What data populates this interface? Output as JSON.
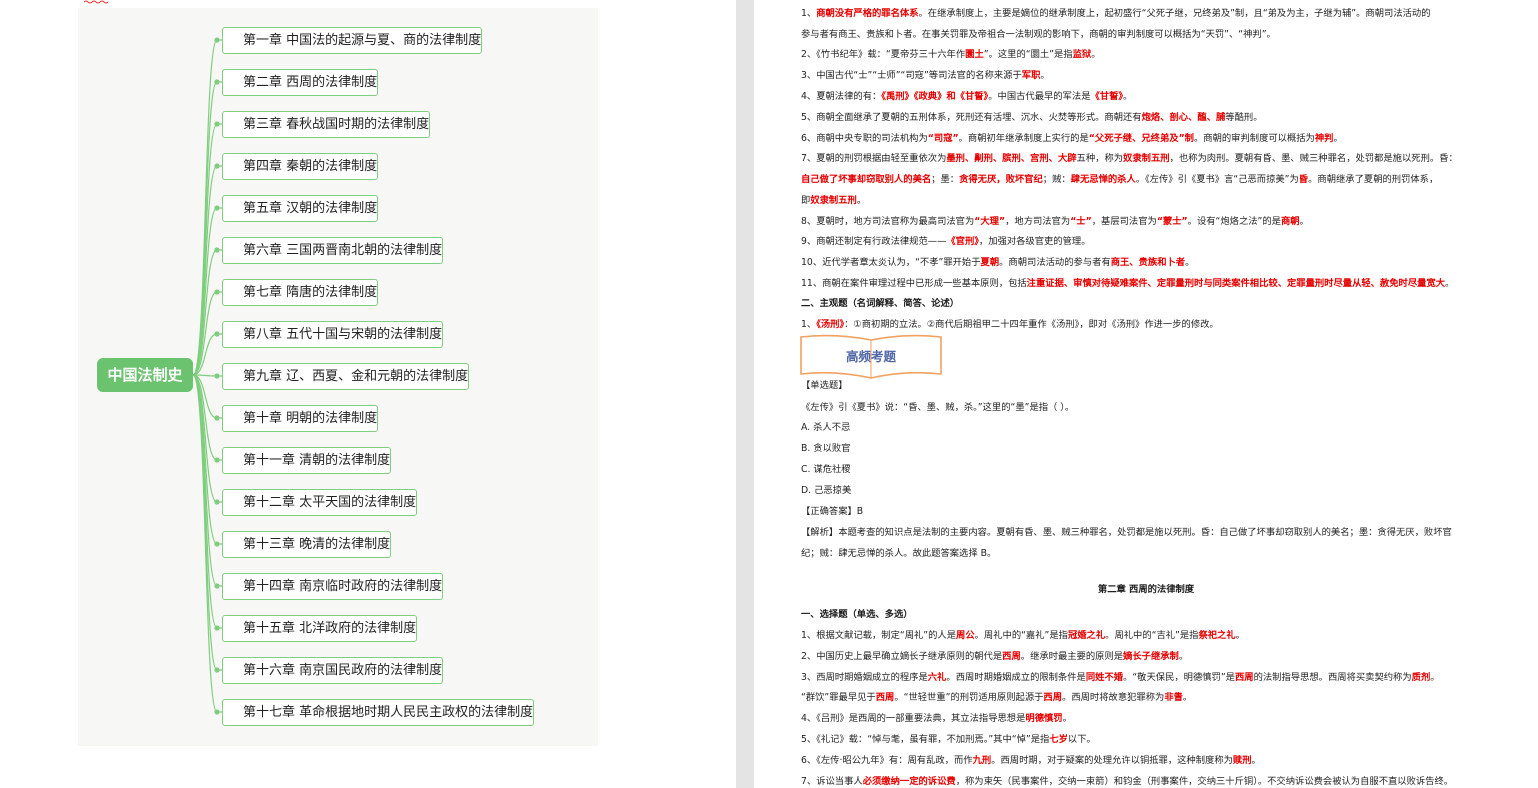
{
  "mindmap": {
    "root": "中国法制史",
    "chapters": [
      "第一章 中国法的起源与夏、商的法律制度",
      "第二章 西周的法律制度",
      "第三章 春秋战国时期的法律制度",
      "第四章 秦朝的法律制度",
      "第五章 汉朝的法律制度",
      "第六章 三国两晋南北朝的法律制度",
      "第七章 隋唐的法律制度",
      "第八章 五代十国与宋朝的法律制度",
      "第九章 辽、西夏、金和元朝的法律制度",
      "第十章 明朝的法律制度",
      "第十一章 清朝的法律制度",
      "第十二章 太平天国的法律制度",
      "第十三章 晚清的法律制度",
      "第十四章 南京临时政府的法律制度",
      "第十五章 北洋政府的法律制度",
      "第十六章 南京国民政府的法律制度",
      "第十七章 革命根据地时期人民民主政权的法律制度"
    ],
    "colors": {
      "root": "#6cc36f",
      "branch": "#7fce7f",
      "background": "#f7f7f5"
    }
  },
  "doc": {
    "lines": [
      [
        [
          "1、",
          ""
        ],
        [
          "商朝没有严格的罪名体系",
          "r"
        ],
        [
          "。在继承制度上，主要是嫡位的继承制度上，起初盛行“父死子继，兄终弟及”制，且“弟及为主，子继为辅”。商朝司法活动的",
          ""
        ]
      ],
      [
        [
          "参与者有商王、贵族和卜者。在事关罚罪及帝祖合一法制观的影响下，商朝的审判制度可以概括为“天罚”、“神判”。",
          ""
        ]
      ],
      [
        [
          "2、《竹书纪年》载：“夏帝芬三十六年作",
          ""
        ],
        [
          "圜土",
          "r"
        ],
        [
          "”。这里的“圜土”是指",
          ""
        ],
        [
          "监狱",
          "r"
        ],
        [
          "。",
          ""
        ]
      ],
      [
        [
          "3、中国古代“士”“士师”“司寇”等司法官的名称来源于",
          ""
        ],
        [
          "军职",
          "r"
        ],
        [
          "。",
          ""
        ]
      ],
      [
        [
          "4、夏朝法律的有：",
          ""
        ],
        [
          "《禹刑》《政典》和《甘誓》",
          "r"
        ],
        [
          "。中国古代最早的军法是",
          ""
        ],
        [
          "《甘誓》",
          "r"
        ],
        [
          "。",
          ""
        ]
      ],
      [
        [
          "5、商朝全面继承了夏朝的五刑体系，死刑还有活埋、沉水、火焚等形式。商朝还有",
          ""
        ],
        [
          "炮烙、剖心、醢、脯",
          "r"
        ],
        [
          "等酷刑。",
          ""
        ]
      ],
      [
        [
          "6、商朝中央专职的司法机构为",
          ""
        ],
        [
          "“司寇”",
          "r"
        ],
        [
          "。商朝初年继承制度上实行的是",
          ""
        ],
        [
          "“父死子继、兄终弟及”制",
          "r"
        ],
        [
          "。商朝的审判制度可以概括为",
          ""
        ],
        [
          "神判",
          "r"
        ],
        [
          "。",
          ""
        ]
      ],
      [
        [
          "7、夏朝的刑罚根据由轻至重依次为",
          ""
        ],
        [
          "墨刑、劓刑、膑刑、宫刑、大辟",
          "r"
        ],
        [
          "五种，称为",
          ""
        ],
        [
          "奴隶制五刑",
          "r"
        ],
        [
          "，也称为肉刑。夏朝有昏、墨、贼三种罪名，处罚都是施以死刑。昏：",
          ""
        ]
      ],
      [
        [
          "自己做了坏事却窃取别人的美名",
          "r"
        ],
        [
          "；墨：",
          ""
        ],
        [
          "贪得无厌，败坏官纪",
          "r"
        ],
        [
          "；贼：",
          ""
        ],
        [
          "肆无忌惮的杀人",
          "r"
        ],
        [
          "。《左传》引《夏书》言“己恶而掠美”为",
          ""
        ],
        [
          "昏",
          "r"
        ],
        [
          "。商朝继承了夏朝的刑罚体系，",
          ""
        ]
      ],
      [
        [
          "即",
          ""
        ],
        [
          "奴隶制五刑",
          "r"
        ],
        [
          "。",
          ""
        ]
      ],
      [
        [
          "8、夏朝时，地方司法官称为最高司法官为",
          ""
        ],
        [
          "“大理”",
          "r"
        ],
        [
          "，地方司法官为",
          ""
        ],
        [
          "“士”",
          "r"
        ],
        [
          "，基层司法官为",
          ""
        ],
        [
          "“蒙士”",
          "r"
        ],
        [
          "。设有“炮烙之法”的是",
          ""
        ],
        [
          "商朝",
          "r"
        ],
        [
          "。",
          ""
        ]
      ],
      [
        [
          "9、商朝还制定有行政法律规范——",
          ""
        ],
        [
          "《官刑》",
          "r"
        ],
        [
          "，加强对各级官吏的管理。",
          ""
        ]
      ],
      [
        [
          "10、近代学者章太炎认为，“不孝”罪开始于",
          ""
        ],
        [
          "夏朝",
          "r"
        ],
        [
          "。商朝司法活动的参与者有",
          ""
        ],
        [
          "商王、贵族和卜者",
          "r"
        ],
        [
          "。",
          ""
        ]
      ],
      [
        [
          "11、商朝在案件审理过程中已形成一些基本原则，包括",
          ""
        ],
        [
          "注重证据、审慎对待疑难案件、定罪量刑时与同类案件相比较、定罪量刑时尽量从轻、赦免时尽量宽大",
          "r"
        ],
        [
          "。",
          ""
        ]
      ],
      [
        [
          "二、主观题（名词解释、简答、论述）",
          "b"
        ]
      ],
      [
        [
          "1、",
          ""
        ],
        [
          "《汤刑》",
          "r"
        ],
        [
          "：①商初期的立法。②商代后期祖甲二十四年重作《汤刑》，即对《汤刑》作进一步的修改。",
          ""
        ]
      ]
    ],
    "banner": "高频考题",
    "question": [
      [
        [
          "【单选题】",
          ""
        ]
      ],
      [
        [
          "《左传》引《夏书》说：“昏、墨、贼，杀。”这里的“墨”是指（ ）。",
          ""
        ]
      ],
      [
        [
          "A. 杀人不忌",
          ""
        ]
      ],
      [
        [
          "B. 贪以败官",
          ""
        ]
      ],
      [
        [
          "C. 谋危社稷",
          ""
        ]
      ],
      [
        [
          "D. 己恶掠美",
          ""
        ]
      ],
      [
        [
          "【正确答案】B",
          ""
        ]
      ],
      [
        [
          "【解析】本题考查的知识点是法制的主要内容。夏朝有昏、墨、贼三种罪名，处罚都是施以死刑。昏：自己做了坏事却窃取别人的美名；墨：贪得无厌，败坏官",
          ""
        ]
      ],
      [
        [
          "纪；贼：肆无忌惮的杀人。故此题答案选择 B。",
          ""
        ]
      ]
    ],
    "chapter2_title": "第二章 西周的法律制度",
    "chapter2": [
      [
        [
          "一、选择题（单选、多选）",
          "b"
        ]
      ],
      [
        [
          "1、根据文献记载，制定“周礼”的人是",
          ""
        ],
        [
          "周公",
          "r"
        ],
        [
          "。周礼中的“嘉礼”是指",
          ""
        ],
        [
          "冠婚之礼",
          "r"
        ],
        [
          "。周礼中的“吉礼”是指",
          ""
        ],
        [
          "祭祀之礼",
          "r"
        ],
        [
          "。",
          ""
        ]
      ],
      [
        [
          "2、中国历史上最早确立嫡长子继承原则的朝代是",
          ""
        ],
        [
          "西周",
          "r"
        ],
        [
          "。继承时最主要的原则是",
          ""
        ],
        [
          "嫡长子继承制",
          "r"
        ],
        [
          "。",
          ""
        ]
      ],
      [
        [
          "3、西周时期婚姻成立的程序是",
          ""
        ],
        [
          "六礼",
          "r"
        ],
        [
          "。西周时期婚姻成立的限制条件是",
          ""
        ],
        [
          "同姓不婚",
          "r"
        ],
        [
          "。“敬天保民，明德慎罚”是",
          ""
        ],
        [
          "西周",
          "r"
        ],
        [
          "的法制指导思想。西周将买卖契约称为",
          ""
        ],
        [
          "质剂",
          "r"
        ],
        [
          "。",
          ""
        ]
      ],
      [
        [
          "“群饮”罪最早见于",
          ""
        ],
        [
          "西周",
          "r"
        ],
        [
          "。“世轻世重”的刑罚适用原则起源于",
          ""
        ],
        [
          "西周",
          "r"
        ],
        [
          "。西周时将故意犯罪称为",
          ""
        ],
        [
          "非眚",
          "r"
        ],
        [
          "。",
          ""
        ]
      ],
      [
        [
          "4、《吕刑》是西周的一部重要法典，其立法指导思想是",
          ""
        ],
        [
          "明德慎罚",
          "r"
        ],
        [
          "。",
          ""
        ]
      ],
      [
        [
          "5、《礼记》载：“悼与耄，虽有罪，不加刑焉。”其中“悼”是指",
          ""
        ],
        [
          "七岁",
          "r"
        ],
        [
          "以下。",
          ""
        ]
      ],
      [
        [
          "6、《左传·昭公九年》有：周有乱政，而作",
          ""
        ],
        [
          "九刑",
          "r"
        ],
        [
          "。西周时期，对于疑案的处理允许以铜抵罪，这种制度称为",
          ""
        ],
        [
          "赎刑",
          "r"
        ],
        [
          "。",
          ""
        ]
      ],
      [
        [
          "7、诉讼当事人",
          ""
        ],
        [
          "必须缴纳一定的诉讼费",
          "r"
        ],
        [
          "，称为束矢（民事案件，交纳一束箭）和钧金（刑事案件，交纳三十斤铜）。不交纳诉讼费会被认为自服不直以败诉告终。",
          ""
        ]
      ]
    ]
  }
}
